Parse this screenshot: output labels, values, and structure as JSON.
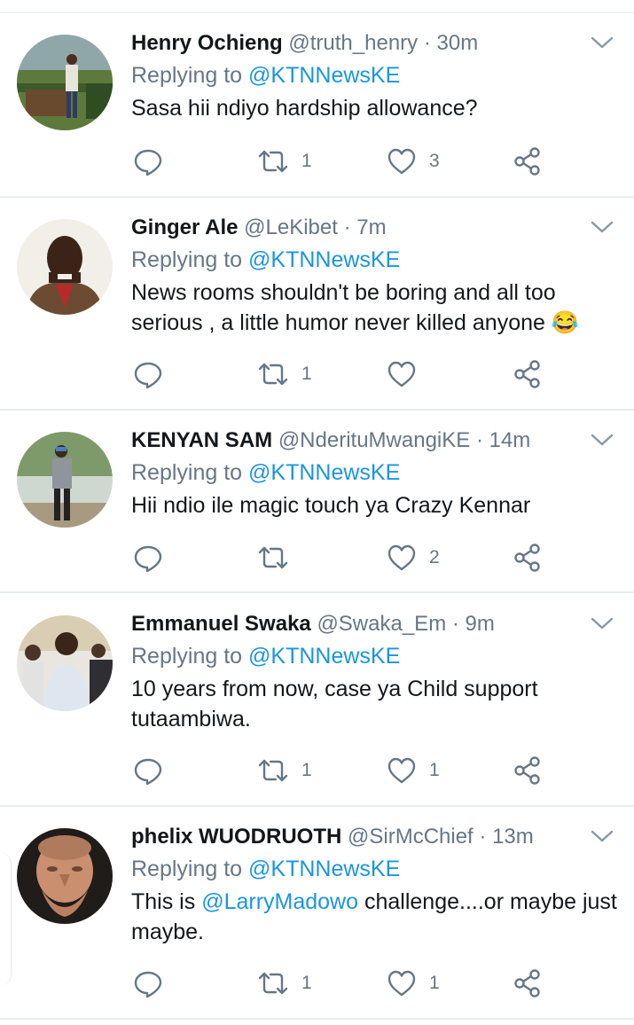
{
  "colors": {
    "accent": "#1b95e0",
    "muted": "#657786",
    "text": "#14171a",
    "divider": "#e6ecf0"
  },
  "tweets": [
    {
      "name": "Henry Ochieng",
      "handle": "@truth_henry",
      "sep": "·",
      "time": "30m",
      "replying_prefix": "Replying to ",
      "replying_to": "@KTNNewsKE",
      "text": "Sasa hii ndiyo hardship allowance?",
      "retweets": "1",
      "likes": "3",
      "avatar_icon": "person-outdoor-avatar"
    },
    {
      "name": "Ginger Ale",
      "handle": "@LeKibet",
      "sep": "·",
      "time": "7m",
      "replying_prefix": "Replying to ",
      "replying_to": "@KTNNewsKE",
      "text": "News rooms shouldn't be boring and all too serious , a little humor never killed anyone 😂",
      "retweets": "1",
      "likes": "",
      "avatar_icon": "person-smiling-avatar"
    },
    {
      "name": "KENYAN SAM",
      "handle": "@NderituMwangiKE",
      "sep": "·",
      "time": "14m",
      "replying_prefix": "Replying to ",
      "replying_to": "@KTNNewsKE",
      "text": "Hii ndio ile magic touch ya Crazy Kennar",
      "retweets": "",
      "likes": "2",
      "avatar_icon": "person-standing-avatar"
    },
    {
      "name": "Emmanuel Swaka",
      "handle": "@Swaka_Em",
      "sep": "·",
      "time": "9m",
      "replying_prefix": "Replying to ",
      "replying_to": "@KTNNewsKE",
      "text": "10 years from now, case ya Child support tutaambiwa.",
      "retweets": "1",
      "likes": "1",
      "avatar_icon": "person-group-avatar"
    },
    {
      "name": "phelix WUODRUOTH",
      "handle": "@SirMcChief",
      "sep": "·",
      "time": "13m",
      "replying_prefix": "Replying to ",
      "replying_to": "@KTNNewsKE",
      "text_pre": "This is ",
      "text_mention": "@LarryMadowo",
      "text_post": " challenge....or maybe just maybe.",
      "retweets": "1",
      "likes": "1",
      "avatar_icon": "statue-bust-avatar"
    }
  ]
}
